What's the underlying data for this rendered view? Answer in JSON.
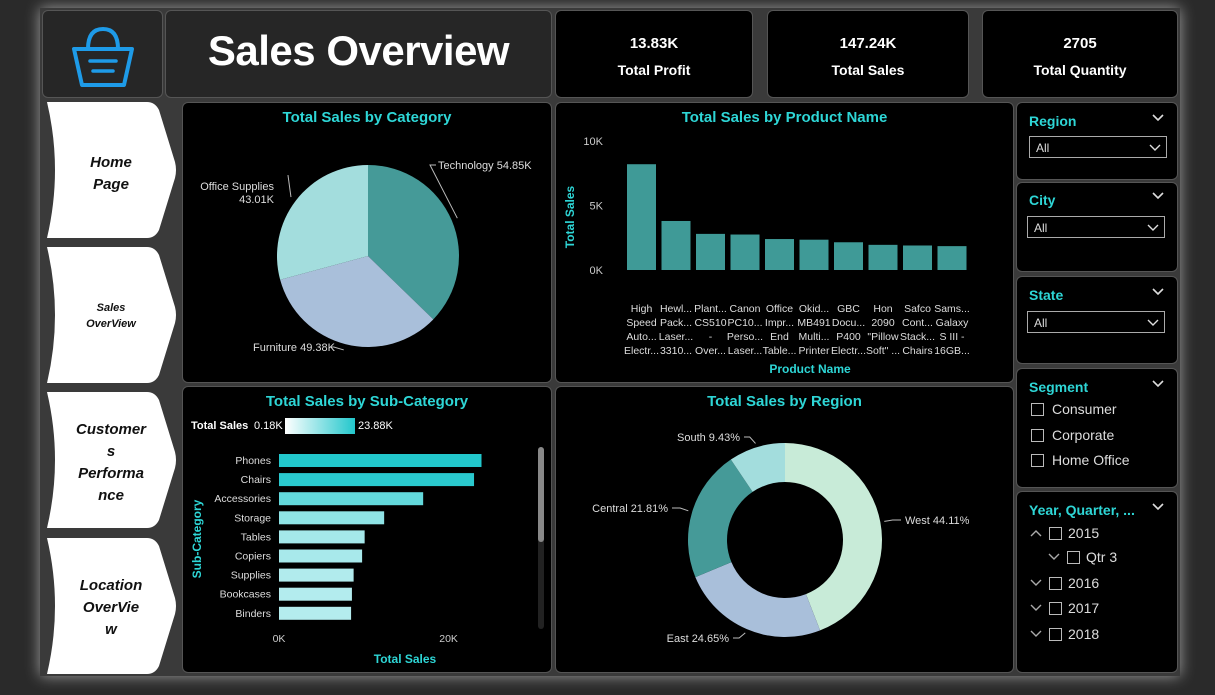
{
  "header": {
    "title": "Sales Overview"
  },
  "kpis": [
    {
      "value": "13.83K",
      "label": "Total Profit"
    },
    {
      "value": "147.24K",
      "label": "Total Sales"
    },
    {
      "value": "2705",
      "label": "Total Quantity"
    }
  ],
  "nav": [
    {
      "lines": [
        "Home",
        "Page"
      ]
    },
    {
      "lines": [
        "Sales",
        "OverView"
      ]
    },
    {
      "lines": [
        "Customer",
        "s",
        "Performa",
        "nce"
      ]
    },
    {
      "lines": [
        "Location",
        "OverVie",
        "w"
      ]
    }
  ],
  "slicers": {
    "region": {
      "title": "Region",
      "value": "All"
    },
    "city": {
      "title": "City",
      "value": "All"
    },
    "state": {
      "title": "State",
      "value": "All"
    },
    "segment": {
      "title": "Segment",
      "options": [
        "Consumer",
        "Corporate",
        "Home Office"
      ]
    },
    "date": {
      "title": "Year, Quarter, ...",
      "items": [
        "2015",
        "Qtr 3",
        "2016",
        "2017",
        "2018"
      ]
    }
  },
  "colors": {
    "accent": "#2ed6d6",
    "bar": "#3f9a97",
    "teal": "#459a98",
    "lavender": "#a9bfda",
    "mint": "#a3dddd",
    "west": "#c8ebd8"
  },
  "chart_data": [
    {
      "type": "pie",
      "title": "Total Sales by Category",
      "slices": [
        {
          "label": "Technology",
          "value": 54.85,
          "text": "Technology 54.85K"
        },
        {
          "label": "Furniture",
          "value": 49.38,
          "text": "Furniture 49.38K"
        },
        {
          "label": "Office Supplies",
          "value": 43.01,
          "text": "Office Supplies 43.01K"
        }
      ],
      "unit": "K"
    },
    {
      "type": "bar",
      "title": "Total Sales by Product Name",
      "xlabel": "Product Name",
      "ylabel": "Total Sales",
      "ylim": [
        0,
        10000
      ],
      "yticks": [
        "0K",
        "5K",
        "10K"
      ],
      "categories": [
        [
          "High",
          "Speed",
          "Auto...",
          "Electr..."
        ],
        [
          "Hewl...",
          "Pack...",
          "Laser...",
          "3310..."
        ],
        [
          "Plant...",
          "CS510",
          "-",
          "Over..."
        ],
        [
          "Canon",
          "PC10...",
          "Perso...",
          "Laser..."
        ],
        [
          "Office",
          "Impr...",
          "End",
          "Table..."
        ],
        [
          "Okid...",
          "MB491",
          "Multi...",
          "Printer"
        ],
        [
          "GBC",
          "Docu...",
          "P400",
          "Electr..."
        ],
        [
          "Hon",
          "2090",
          "\"Pillow",
          "Soft\" ..."
        ],
        [
          "Safco",
          "Cont...",
          "Stack...",
          "Chairs"
        ],
        [
          "Sams...",
          "Galaxy",
          "S III -",
          "16GB..."
        ]
      ],
      "values": [
        8200,
        3800,
        2800,
        2750,
        2400,
        2350,
        2150,
        1950,
        1900,
        1850
      ]
    },
    {
      "type": "bar",
      "orientation": "horizontal",
      "title": "Total Sales by Sub-Category",
      "xlabel": "Total Sales",
      "ylabel": "Sub-Category",
      "xlim": [
        0,
        25000
      ],
      "xticks": [
        "0K",
        "20K"
      ],
      "legend": {
        "label": "Total Sales",
        "min": "0.18K",
        "max": "23.88K"
      },
      "categories": [
        "Phones",
        "Chairs",
        "Accessories",
        "Storage",
        "Tables",
        "Copiers",
        "Supplies",
        "Bookcases",
        "Binders"
      ],
      "values": [
        23880,
        23000,
        17000,
        12400,
        10100,
        9800,
        8800,
        8600,
        8500
      ]
    },
    {
      "type": "pie",
      "variant": "donut",
      "title": "Total Sales by Region",
      "slices": [
        {
          "label": "West",
          "value": 44.11,
          "text": "West 44.11%"
        },
        {
          "label": "East",
          "value": 24.65,
          "text": "East 24.65%"
        },
        {
          "label": "Central",
          "value": 21.81,
          "text": "Central 21.81%"
        },
        {
          "label": "South",
          "value": 9.43,
          "text": "South 9.43%"
        }
      ],
      "unit": "%"
    }
  ]
}
